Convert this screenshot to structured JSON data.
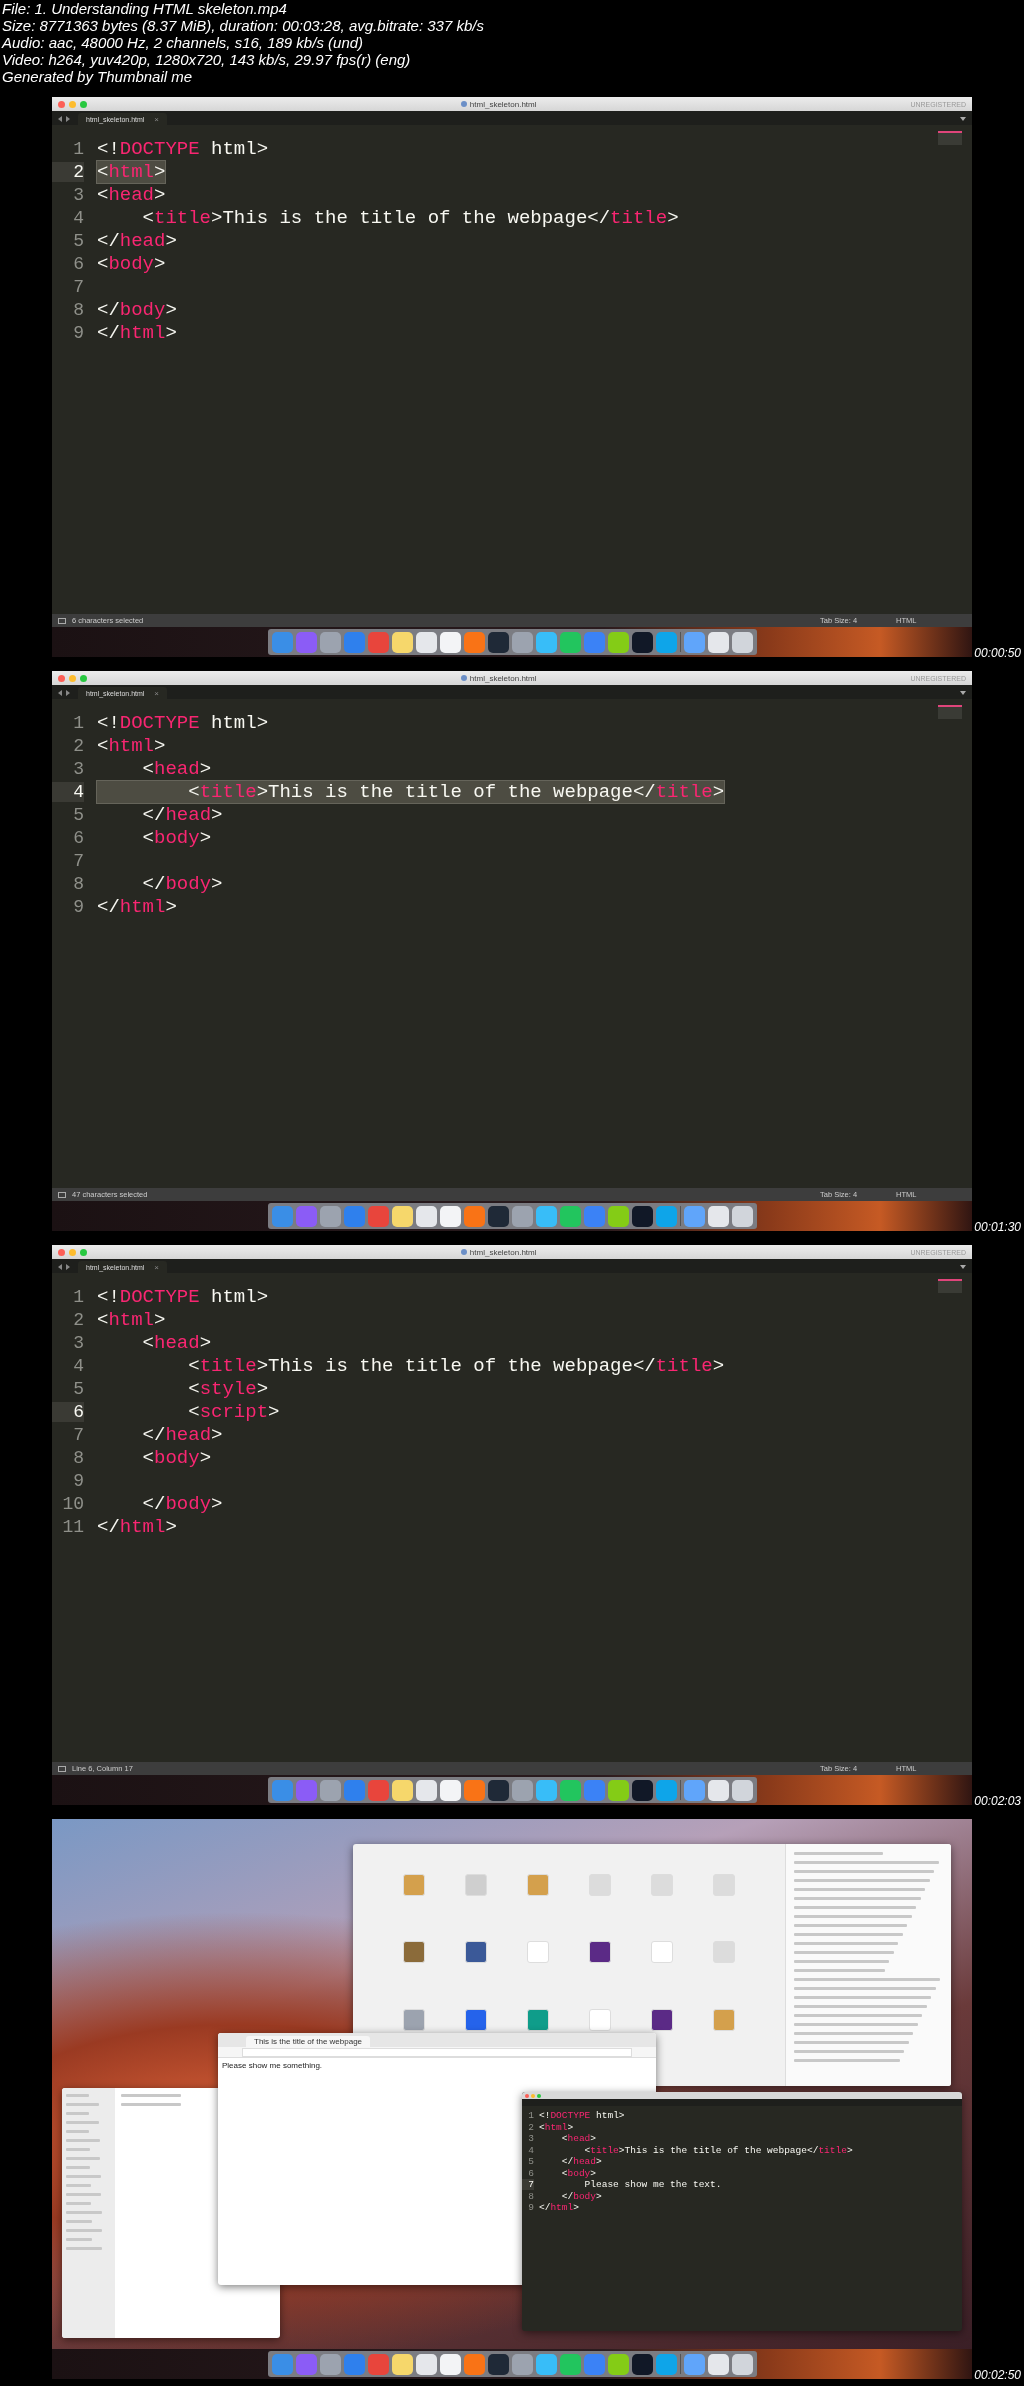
{
  "header": {
    "lines": [
      "File: 1. Understanding HTML skeleton.mp4",
      "Size: 8771363 bytes (8.37 MiB), duration: 00:03:28, avg.bitrate: 337 kb/s",
      "Audio: aac, 48000 Hz, 2 channels, s16, 189 kb/s (und)",
      "Video: h264, yuv420p, 1280x720, 143 kb/s, 29.97 fps(r) (eng)",
      "Generated by Thumbnail me"
    ]
  },
  "frames": [
    {
      "kind": "editor",
      "window_title": "html_skeleton.html",
      "license": "UNREGISTERED",
      "tab": {
        "label": "html_skeleton.html",
        "close": "×"
      },
      "lines": [
        {
          "number": "1",
          "current": false,
          "selected": false,
          "tokens": [
            {
              "kind": "plain",
              "text": "<!"
            },
            {
              "kind": "tag",
              "text": "DOCTYPE"
            },
            {
              "kind": "plain",
              "text": " html>"
            }
          ]
        },
        {
          "number": "2",
          "current": true,
          "selected": true,
          "tokens": [
            {
              "kind": "plain",
              "text": "<"
            },
            {
              "kind": "tag",
              "text": "html"
            },
            {
              "kind": "plain",
              "text": ">"
            }
          ]
        },
        {
          "number": "3",
          "current": false,
          "selected": false,
          "tokens": [
            {
              "kind": "plain",
              "text": "<"
            },
            {
              "kind": "tag",
              "text": "head"
            },
            {
              "kind": "plain",
              "text": ">"
            }
          ]
        },
        {
          "number": "4",
          "current": false,
          "selected": false,
          "tokens": [
            {
              "kind": "plain",
              "text": "    <"
            },
            {
              "kind": "tag",
              "text": "title"
            },
            {
              "kind": "plain",
              "text": ">This is the title of the webpage</"
            },
            {
              "kind": "tag",
              "text": "title"
            },
            {
              "kind": "plain",
              "text": ">"
            }
          ]
        },
        {
          "number": "5",
          "current": false,
          "selected": false,
          "tokens": [
            {
              "kind": "plain",
              "text": "</"
            },
            {
              "kind": "tag",
              "text": "head"
            },
            {
              "kind": "plain",
              "text": ">"
            }
          ]
        },
        {
          "number": "6",
          "current": false,
          "selected": false,
          "tokens": [
            {
              "kind": "plain",
              "text": "<"
            },
            {
              "kind": "tag",
              "text": "body"
            },
            {
              "kind": "plain",
              "text": ">"
            }
          ]
        },
        {
          "number": "7",
          "current": false,
          "selected": false
        },
        {
          "number": "8",
          "current": false,
          "selected": false,
          "tokens": [
            {
              "kind": "plain",
              "text": "</"
            },
            {
              "kind": "tag",
              "text": "body"
            },
            {
              "kind": "plain",
              "text": ">"
            }
          ]
        },
        {
          "number": "9",
          "current": false,
          "selected": false,
          "tokens": [
            {
              "kind": "plain",
              "text": "</"
            },
            {
              "kind": "tag",
              "text": "html"
            },
            {
              "kind": "plain",
              "text": ">"
            }
          ]
        }
      ],
      "status": {
        "message": "6 characters selected",
        "tab_size": "Tab Size: 4",
        "syntax": "HTML"
      },
      "timestamp": "00:00:50"
    },
    {
      "kind": "editor",
      "window_title": "html_skeleton.html",
      "license": "UNREGISTERED",
      "tab": {
        "label": "html_skeleton.html",
        "close": "×"
      },
      "lines": [
        {
          "number": "1",
          "current": false,
          "selected": false,
          "tokens": [
            {
              "kind": "plain",
              "text": "<!"
            },
            {
              "kind": "tag",
              "text": "DOCTYPE"
            },
            {
              "kind": "plain",
              "text": " html>"
            }
          ]
        },
        {
          "number": "2",
          "current": false,
          "selected": false,
          "tokens": [
            {
              "kind": "plain",
              "text": "<"
            },
            {
              "kind": "tag",
              "text": "html"
            },
            {
              "kind": "plain",
              "text": ">"
            }
          ]
        },
        {
          "number": "3",
          "current": false,
          "selected": false,
          "tokens": [
            {
              "kind": "plain",
              "text": "    <"
            },
            {
              "kind": "tag",
              "text": "head"
            },
            {
              "kind": "plain",
              "text": ">"
            }
          ]
        },
        {
          "number": "4",
          "current": true,
          "selected": true,
          "tokens": [
            {
              "kind": "plain",
              "text": "        <"
            },
            {
              "kind": "tag",
              "text": "title"
            },
            {
              "kind": "plain",
              "text": ">This is the title of the webpage</"
            },
            {
              "kind": "tag",
              "text": "title"
            },
            {
              "kind": "plain",
              "text": ">"
            }
          ]
        },
        {
          "number": "5",
          "current": false,
          "selected": false,
          "tokens": [
            {
              "kind": "plain",
              "text": "    </"
            },
            {
              "kind": "tag",
              "text": "head"
            },
            {
              "kind": "plain",
              "text": ">"
            }
          ]
        },
        {
          "number": "6",
          "current": false,
          "selected": false,
          "tokens": [
            {
              "kind": "plain",
              "text": "    <"
            },
            {
              "kind": "tag",
              "text": "body"
            },
            {
              "kind": "plain",
              "text": ">"
            }
          ]
        },
        {
          "number": "7",
          "current": false,
          "selected": false
        },
        {
          "number": "8",
          "current": false,
          "selected": false,
          "tokens": [
            {
              "kind": "plain",
              "text": "    </"
            },
            {
              "kind": "tag",
              "text": "body"
            },
            {
              "kind": "plain",
              "text": ">"
            }
          ]
        },
        {
          "number": "9",
          "current": false,
          "selected": false,
          "tokens": [
            {
              "kind": "plain",
              "text": "</"
            },
            {
              "kind": "tag",
              "text": "html"
            },
            {
              "kind": "plain",
              "text": ">"
            }
          ]
        }
      ],
      "status": {
        "message": "47 characters selected",
        "tab_size": "Tab Size: 4",
        "syntax": "HTML"
      },
      "timestamp": "00:01:30"
    },
    {
      "kind": "editor",
      "window_title": "html_skeleton.html",
      "license": "UNREGISTERED",
      "tab": {
        "label": "html_skeleton.html",
        "close": "×"
      },
      "lines": [
        {
          "number": "1",
          "current": false,
          "selected": false,
          "tokens": [
            {
              "kind": "plain",
              "text": "<!"
            },
            {
              "kind": "tag",
              "text": "DOCTYPE"
            },
            {
              "kind": "plain",
              "text": " html>"
            }
          ]
        },
        {
          "number": "2",
          "current": false,
          "selected": false,
          "tokens": [
            {
              "kind": "plain",
              "text": "<"
            },
            {
              "kind": "tag",
              "text": "html"
            },
            {
              "kind": "plain",
              "text": ">"
            }
          ]
        },
        {
          "number": "3",
          "current": false,
          "selected": false,
          "tokens": [
            {
              "kind": "plain",
              "text": "    <"
            },
            {
              "kind": "tag",
              "text": "head"
            },
            {
              "kind": "plain",
              "text": ">"
            }
          ]
        },
        {
          "number": "4",
          "current": false,
          "selected": false,
          "tokens": [
            {
              "kind": "plain",
              "text": "        <"
            },
            {
              "kind": "tag",
              "text": "title"
            },
            {
              "kind": "plain",
              "text": ">This is the title of the webpage</"
            },
            {
              "kind": "tag",
              "text": "title"
            },
            {
              "kind": "plain",
              "text": ">"
            }
          ]
        },
        {
          "number": "5",
          "current": false,
          "selected": false,
          "tokens": [
            {
              "kind": "plain",
              "text": "        <"
            },
            {
              "kind": "tag",
              "text": "style"
            },
            {
              "kind": "plain",
              "text": ">"
            }
          ]
        },
        {
          "number": "6",
          "current": true,
          "selected": false,
          "tokens": [
            {
              "kind": "plain",
              "text": "        <"
            },
            {
              "kind": "tag",
              "text": "script"
            },
            {
              "kind": "plain",
              "text": ">"
            }
          ]
        },
        {
          "number": "7",
          "current": false,
          "selected": false,
          "tokens": [
            {
              "kind": "plain",
              "text": "    </"
            },
            {
              "kind": "tag",
              "text": "head"
            },
            {
              "kind": "plain",
              "text": ">"
            }
          ]
        },
        {
          "number": "8",
          "current": false,
          "selected": false,
          "tokens": [
            {
              "kind": "plain",
              "text": "    <"
            },
            {
              "kind": "tag",
              "text": "body"
            },
            {
              "kind": "plain",
              "text": ">"
            }
          ]
        },
        {
          "number": "9",
          "current": false,
          "selected": false
        },
        {
          "number": "10",
          "current": false,
          "selected": false,
          "tokens": [
            {
              "kind": "plain",
              "text": "    </"
            },
            {
              "kind": "tag",
              "text": "body"
            },
            {
              "kind": "plain",
              "text": ">"
            }
          ]
        },
        {
          "number": "11",
          "current": false,
          "selected": false,
          "tokens": [
            {
              "kind": "plain",
              "text": "</"
            },
            {
              "kind": "tag",
              "text": "html"
            },
            {
              "kind": "plain",
              "text": ">"
            }
          ]
        }
      ],
      "status": {
        "message": "Line 6, Column 17",
        "tab_size": "Tab Size: 4",
        "syntax": "HTML"
      },
      "timestamp": "00:02:03"
    },
    {
      "kind": "desktop",
      "browser": {
        "tab": "This is the title of the webpage",
        "content": "Please show me something."
      },
      "editor": {
        "lines": [
          {
            "number": "1",
            "current": false,
            "selected": false,
            "tokens": [
              {
                "kind": "plain",
                "text": "<!"
              },
              {
                "kind": "tag",
                "text": "DOCTYPE"
              },
              {
                "kind": "plain",
                "text": " html>"
              }
            ]
          },
          {
            "number": "2",
            "current": false,
            "selected": false,
            "tokens": [
              {
                "kind": "plain",
                "text": "<"
              },
              {
                "kind": "tag",
                "text": "html"
              },
              {
                "kind": "plain",
                "text": ">"
              }
            ]
          },
          {
            "number": "3",
            "current": false,
            "selected": false,
            "tokens": [
              {
                "kind": "plain",
                "text": "    <"
              },
              {
                "kind": "tag",
                "text": "head"
              },
              {
                "kind": "plain",
                "text": ">"
              }
            ]
          },
          {
            "number": "4",
            "current": false,
            "selected": false,
            "tokens": [
              {
                "kind": "plain",
                "text": "        <"
              },
              {
                "kind": "tag",
                "text": "title"
              },
              {
                "kind": "plain",
                "text": ">This is the title of the webpage</"
              },
              {
                "kind": "tag",
                "text": "title"
              },
              {
                "kind": "plain",
                "text": ">"
              }
            ]
          },
          {
            "number": "5",
            "current": false,
            "selected": false,
            "tokens": [
              {
                "kind": "plain",
                "text": "    </"
              },
              {
                "kind": "tag",
                "text": "head"
              },
              {
                "kind": "plain",
                "text": ">"
              }
            ]
          },
          {
            "number": "6",
            "current": false,
            "selected": false,
            "tokens": [
              {
                "kind": "plain",
                "text": "    <"
              },
              {
                "kind": "tag",
                "text": "body"
              },
              {
                "kind": "plain",
                "text": ">"
              }
            ]
          },
          {
            "number": "7",
            "current": true,
            "selected": false,
            "tokens": [
              {
                "kind": "plain",
                "text": "        Please show me the text."
              }
            ]
          },
          {
            "number": "8",
            "current": false,
            "selected": false,
            "tokens": [
              {
                "kind": "plain",
                "text": "    </"
              },
              {
                "kind": "tag",
                "text": "body"
              },
              {
                "kind": "plain",
                "text": ">"
              }
            ]
          },
          {
            "number": "9",
            "current": false,
            "selected": false,
            "tokens": [
              {
                "kind": "plain",
                "text": "</"
              },
              {
                "kind": "tag",
                "text": "html"
              },
              {
                "kind": "plain",
                "text": ">"
              }
            ]
          }
        ]
      },
      "timestamp": "00:02:50"
    }
  ]
}
